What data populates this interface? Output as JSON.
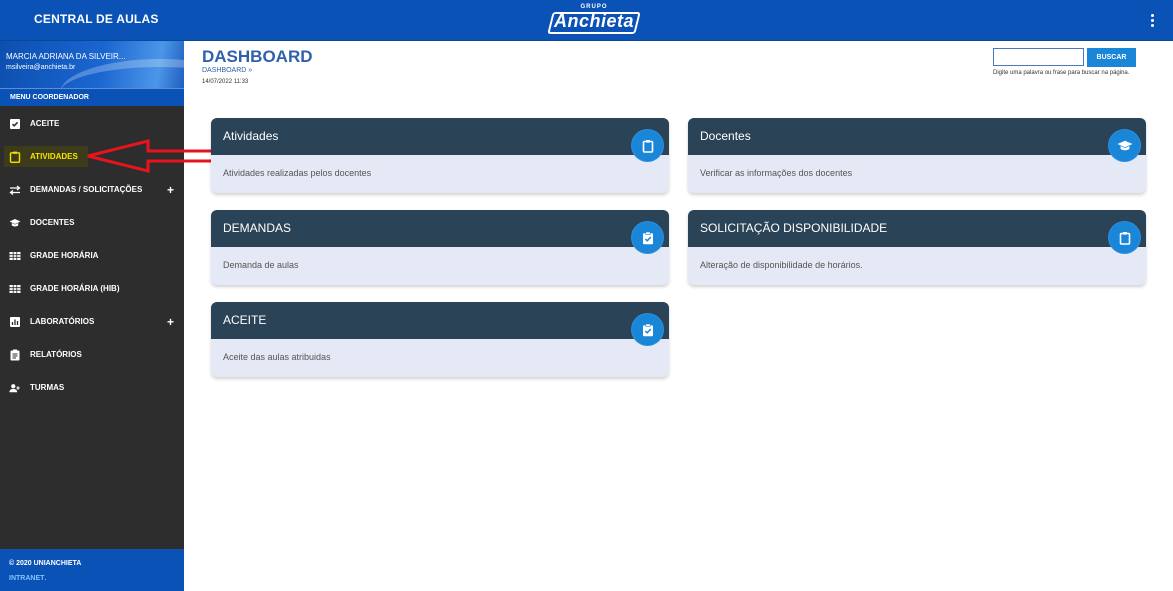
{
  "topbar": {
    "app_title": "CENTRAL DE AULAS",
    "logo_small": "GRUPO",
    "logo_main": "Anchieta"
  },
  "sidebar": {
    "user_name": "MARCIA ADRIANA DA SILVEIR...",
    "user_email": "msilveira@anchieta.br",
    "menu_header": "MENU COORDENADOR",
    "items": [
      {
        "label": "ACEITE",
        "icon": "clipboard-check-icon"
      },
      {
        "label": "ATIVIDADES",
        "icon": "clipboard-icon",
        "active": true
      },
      {
        "label": "DEMANDAS / SOLICITAÇÕES",
        "icon": "exchange-icon",
        "expandable": "+"
      },
      {
        "label": "DOCENTES",
        "icon": "graduation-cap-icon"
      },
      {
        "label": "GRADE HORÁRIA",
        "icon": "table-icon"
      },
      {
        "label": "GRADE HORÁRIA (HIB)",
        "icon": "table-icon"
      },
      {
        "label": "LABORATÓRIOS",
        "icon": "chart-icon",
        "expandable": "+"
      },
      {
        "label": "RELATÓRIOS",
        "icon": "report-icon"
      },
      {
        "label": "TURMAS",
        "icon": "users-icon"
      }
    ],
    "footer_copyright": "© 2020 UNIANCHIETA",
    "footer_link": "INTRANET",
    "footer_dot": "."
  },
  "main": {
    "page_title": "DASHBOARD",
    "breadcrumb": "DASHBOARD »",
    "timestamp": "14/07/2022 11:33",
    "search": {
      "value": "",
      "button_label": "BUSCAR",
      "hint": "Digite uma palavra ou frase para buscar na página."
    },
    "cards": [
      {
        "title": "Atividades",
        "description": "Atividades realizadas pelos docentes",
        "icon": "clipboard-icon"
      },
      {
        "title": "Docentes",
        "description": "Verificar as informações dos docentes",
        "icon": "graduation-cap-icon"
      },
      {
        "title": "DEMANDAS",
        "description": "Demanda de aulas",
        "icon": "clipboard-check-icon"
      },
      {
        "title": "SOLICITAÇÃO DISPONIBILIDADE",
        "description": "Alteração de disponibilidade de horários.",
        "icon": "clipboard-icon"
      },
      {
        "title": "ACEITE",
        "description": "Aceite das aulas atribuidas",
        "icon": "clipboard-check-icon"
      }
    ]
  },
  "colors": {
    "brand_blue": "#0b52b6",
    "sidebar_bg": "#2d2d2d",
    "card_header": "#2b4356",
    "card_body": "#e4e9f5",
    "accent": "#1a86d8",
    "active_text": "#f5e400",
    "annotation_arrow": "#e8141b"
  }
}
